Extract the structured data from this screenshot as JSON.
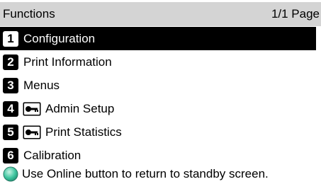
{
  "header": {
    "title": "Functions",
    "page_indicator": "1/1 Page"
  },
  "menu": {
    "items": [
      {
        "number": "1",
        "label": "Configuration",
        "selected": true,
        "locked": false
      },
      {
        "number": "2",
        "label": "Print Information",
        "selected": false,
        "locked": false
      },
      {
        "number": "3",
        "label": "Menus",
        "selected": false,
        "locked": false
      },
      {
        "number": "4",
        "label": "Admin Setup",
        "selected": false,
        "locked": true,
        "icon": "key-icon"
      },
      {
        "number": "5",
        "label": "Print Statistics",
        "selected": false,
        "locked": true,
        "icon": "key-icon"
      },
      {
        "number": "6",
        "label": "Calibration",
        "selected": false,
        "locked": false
      }
    ]
  },
  "footer": {
    "icon": "online-button-icon",
    "message": "Use Online button to return to standby screen."
  },
  "colors": {
    "header_bg": "#d4d4d4",
    "selected_bg": "#000000",
    "online_icon": "#33bb99"
  }
}
